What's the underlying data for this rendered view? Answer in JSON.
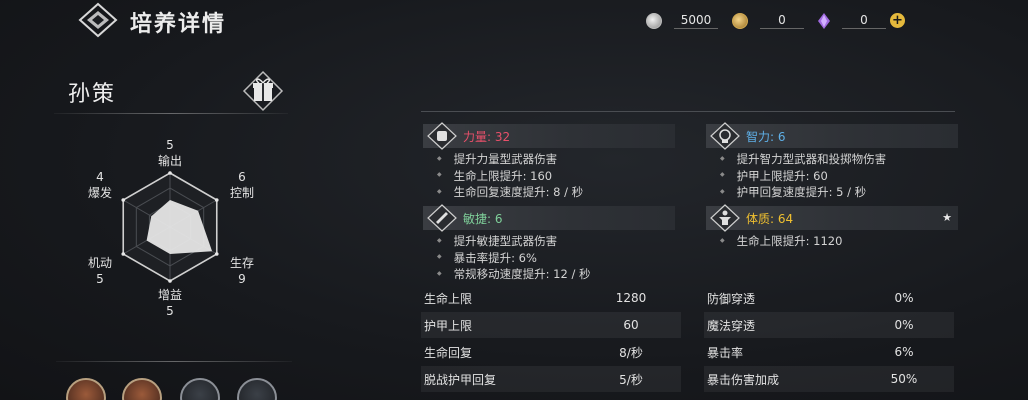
{
  "header": {
    "title": "培养详情",
    "resources": {
      "silver": "5000",
      "gold": "0",
      "gem": "0"
    },
    "add_label": "+"
  },
  "character": {
    "name": "孙策"
  },
  "radar": {
    "axes": [
      {
        "label": "输出",
        "value": "5"
      },
      {
        "label": "控制",
        "value": "6"
      },
      {
        "label": "生存",
        "value": "9"
      },
      {
        "label": "增益",
        "value": "5"
      },
      {
        "label": "机动",
        "value": "5"
      },
      {
        "label": "爆发",
        "value": "4"
      }
    ]
  },
  "attributes": [
    {
      "name": "力量: 32",
      "color": "#e8506a",
      "icon": "fist-icon",
      "lines": [
        "提升力量型武器伤害",
        "生命上限提升: 160",
        "生命回复速度提升: 8 / 秒"
      ]
    },
    {
      "name": "智力: 6",
      "color": "#5fb0e8",
      "icon": "brain-icon",
      "lines": [
        "提升智力型武器和投掷物伤害",
        "护甲上限提升: 60",
        "护甲回复速度提升: 5 / 秒"
      ]
    },
    {
      "name": "敏捷: 6",
      "color": "#7fd09a",
      "icon": "agility-icon",
      "lines": [
        "提升敏捷型武器伤害",
        "暴击率提升: 6%",
        "常规移动速度提升: 12 / 秒"
      ]
    },
    {
      "name": "体质: 64",
      "color": "#f0c030",
      "icon": "body-icon",
      "lines": [
        "生命上限提升: 1120"
      ]
    }
  ],
  "stats_left": [
    {
      "name": "生命上限",
      "value": "1280"
    },
    {
      "name": "护甲上限",
      "value": "60"
    },
    {
      "name": "生命回复",
      "value": "8/秒"
    },
    {
      "name": "脱战护甲回复",
      "value": "5/秒"
    }
  ],
  "stats_right": [
    {
      "name": "防御穿透",
      "value": "0%"
    },
    {
      "name": "魔法穿透",
      "value": "0%"
    },
    {
      "name": "暴击率",
      "value": "6%"
    },
    {
      "name": "暴击伤害加成",
      "value": "50%"
    }
  ],
  "colors": {
    "accent_gold": "#e5b93c",
    "strength": "#e8506a",
    "intelligence": "#5fb0e8",
    "agility": "#7fd09a",
    "constitution": "#f0c030"
  }
}
